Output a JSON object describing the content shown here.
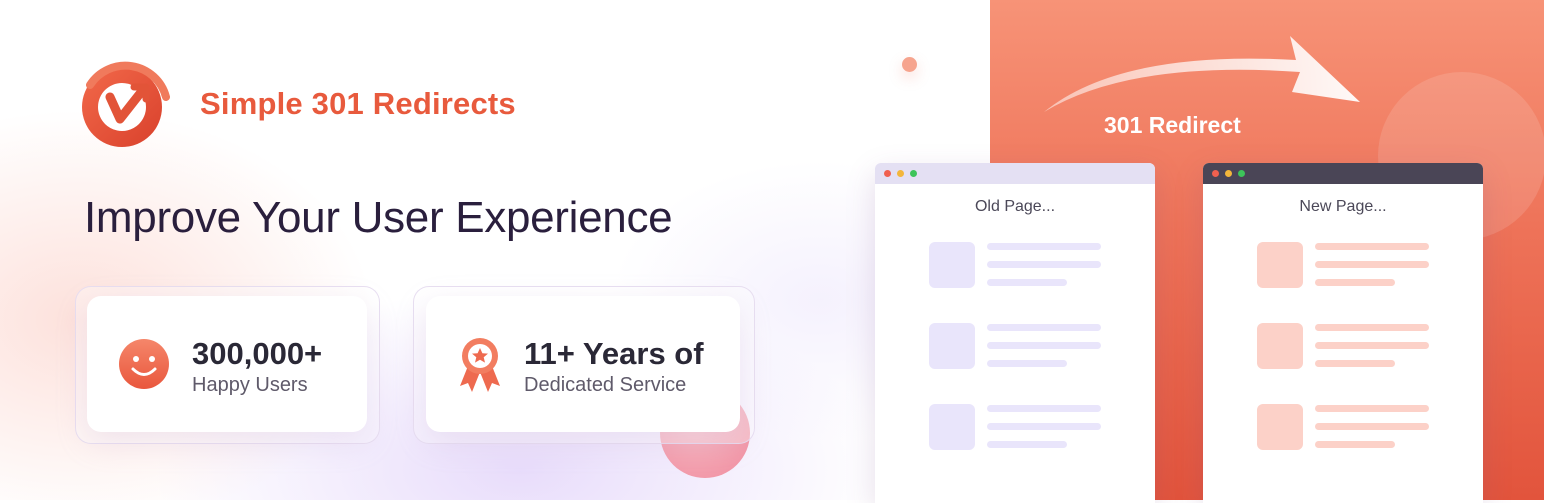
{
  "brand": {
    "name": "Simple 301 Redirects",
    "logo_icon": "redirect-arrow-logo-icon",
    "color": "#e85a3d"
  },
  "headline": "Improve Your User Experience",
  "stats": [
    {
      "value": "300,000+",
      "label": "Happy Users",
      "icon": "smiley-face-icon"
    },
    {
      "value": "11+ Years of",
      "label": "Dedicated Service",
      "icon": "award-ribbon-icon"
    }
  ],
  "diagram": {
    "arrow_label": "301 Redirect",
    "old_window": {
      "title": "Old Page...",
      "accent": "#e9e5fb"
    },
    "new_window": {
      "title": "New Page...",
      "accent": "#fcd1c8"
    }
  },
  "colors": {
    "right_panel": "#ee7359",
    "text_dark": "#2a1f3d"
  }
}
